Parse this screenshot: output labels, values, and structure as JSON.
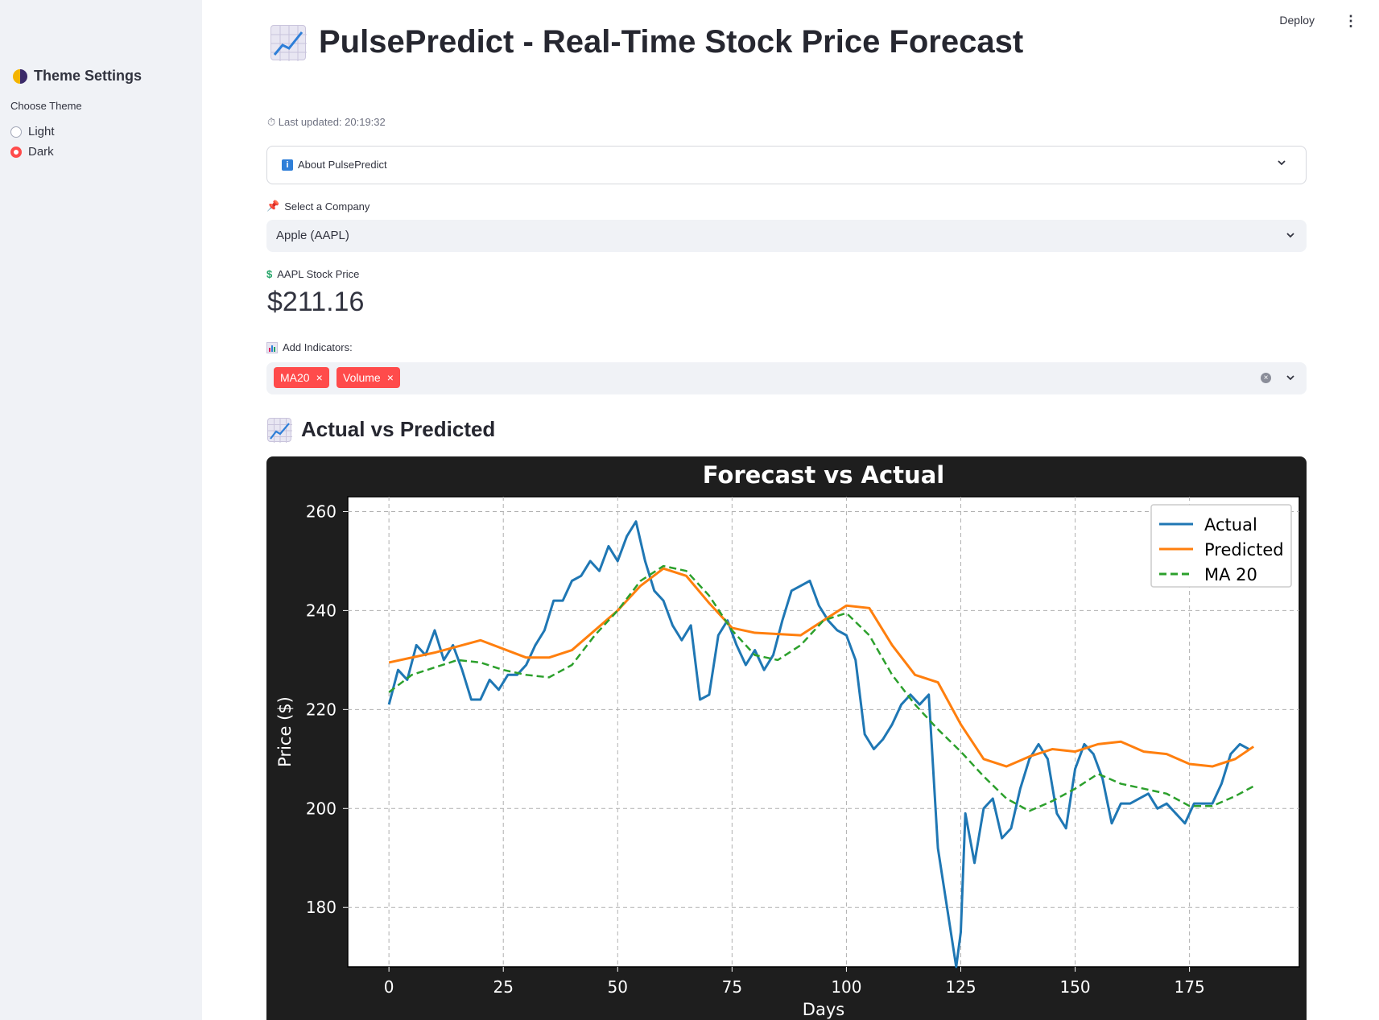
{
  "sidebar": {
    "title": "Theme Settings",
    "theme_label": "Choose Theme",
    "options": [
      {
        "label": "Light",
        "selected": false
      },
      {
        "label": "Dark",
        "selected": true
      }
    ],
    "accent": "#ff4b4b"
  },
  "topbar": {
    "deploy": "Deploy"
  },
  "main": {
    "title": "PulsePredict - Real-Time Stock Price Forecast",
    "last_updated": "⏱ Last updated: 20:19:32",
    "about_label": "About PulsePredict",
    "company_label": "Select a Company",
    "company_value": "Apple (AAPL)",
    "price_label": "AAPL Stock Price",
    "price_value": "$211.16",
    "indicators_label": "Add Indicators:",
    "indicators": [
      "MA20",
      "Volume"
    ],
    "section_title": "Actual vs Predicted"
  },
  "chart_data": {
    "type": "line",
    "title": "Forecast vs Actual",
    "xlabel": "Days",
    "ylabel": "Price ($)",
    "xlim": [
      -9,
      199
    ],
    "ylim": [
      168,
      263
    ],
    "xticks": [
      0,
      25,
      50,
      75,
      100,
      125,
      150,
      175
    ],
    "yticks": [
      180,
      200,
      220,
      240,
      260
    ],
    "grid": true,
    "legend_position": "top-right",
    "series": [
      {
        "name": "Actual",
        "color": "#1f77b4",
        "style": "solid",
        "x": [
          0,
          2,
          4,
          6,
          8,
          10,
          12,
          14,
          16,
          18,
          20,
          22,
          24,
          26,
          28,
          30,
          32,
          34,
          36,
          38,
          40,
          42,
          44,
          46,
          48,
          50,
          52,
          54,
          56,
          58,
          60,
          62,
          64,
          66,
          68,
          70,
          72,
          74,
          76,
          78,
          80,
          82,
          84,
          86,
          88,
          90,
          92,
          94,
          96,
          98,
          100,
          102,
          104,
          106,
          108,
          110,
          112,
          114,
          116,
          118,
          120,
          122,
          124,
          125,
          126,
          128,
          130,
          132,
          134,
          136,
          138,
          140,
          142,
          144,
          146,
          148,
          150,
          152,
          154,
          156,
          158,
          160,
          162,
          164,
          166,
          168,
          170,
          172,
          174,
          176,
          178,
          180,
          182,
          184,
          186,
          188
        ],
        "y": [
          221,
          228,
          226,
          233,
          231,
          236,
          230,
          233,
          228,
          222,
          222,
          226,
          224,
          227,
          227,
          229,
          233,
          236,
          242,
          242,
          246,
          247,
          250,
          248,
          253,
          250,
          255,
          258,
          250,
          244,
          242,
          237,
          234,
          237,
          222,
          223,
          235,
          238,
          233,
          229,
          232,
          228,
          231,
          238,
          244,
          245,
          246,
          241,
          238,
          236,
          235,
          230,
          215,
          212,
          214,
          217,
          221,
          223,
          221,
          223,
          192,
          180,
          168,
          175,
          199,
          189,
          200,
          202,
          194,
          196,
          204,
          210,
          213,
          210,
          199,
          196,
          208,
          213,
          211,
          206,
          197,
          201,
          201,
          202,
          203,
          200,
          201,
          199,
          197,
          201,
          201,
          201,
          205,
          211,
          213,
          212
        ]
      },
      {
        "name": "Predicted",
        "color": "#ff7f0e",
        "style": "solid",
        "x": [
          0,
          10,
          20,
          30,
          35,
          40,
          50,
          55,
          60,
          65,
          70,
          75,
          80,
          90,
          95,
          100,
          105,
          110,
          115,
          120,
          125,
          130,
          135,
          140,
          145,
          150,
          155,
          160,
          165,
          170,
          175,
          180,
          185,
          189
        ],
        "y": [
          229.5,
          231.5,
          234,
          230.5,
          230.5,
          232,
          240,
          245,
          248.5,
          247,
          241.5,
          236.5,
          235.5,
          235,
          238,
          241,
          240.5,
          233,
          227,
          225.5,
          217,
          210,
          208.5,
          210.5,
          212,
          211.5,
          213,
          213.5,
          211.5,
          211,
          209,
          208.5,
          210,
          212.5
        ]
      },
      {
        "name": "MA 20",
        "color": "#2ca02c",
        "style": "dashed",
        "x": [
          0,
          5,
          10,
          15,
          20,
          25,
          30,
          35,
          40,
          45,
          50,
          55,
          60,
          65,
          70,
          75,
          80,
          85,
          90,
          95,
          100,
          105,
          110,
          115,
          120,
          125,
          130,
          135,
          140,
          145,
          150,
          155,
          160,
          165,
          170,
          175,
          180,
          185,
          189
        ],
        "y": [
          223.5,
          227,
          228.5,
          230,
          229.5,
          228,
          227,
          226.5,
          229,
          235,
          240,
          246,
          249,
          248,
          243,
          236,
          231,
          230,
          233,
          238,
          239.5,
          235,
          227,
          221,
          216,
          211.5,
          206.5,
          202,
          199.5,
          201.5,
          204,
          207,
          205,
          204,
          203,
          200.5,
          200.5,
          202.5,
          204.5
        ]
      }
    ]
  }
}
